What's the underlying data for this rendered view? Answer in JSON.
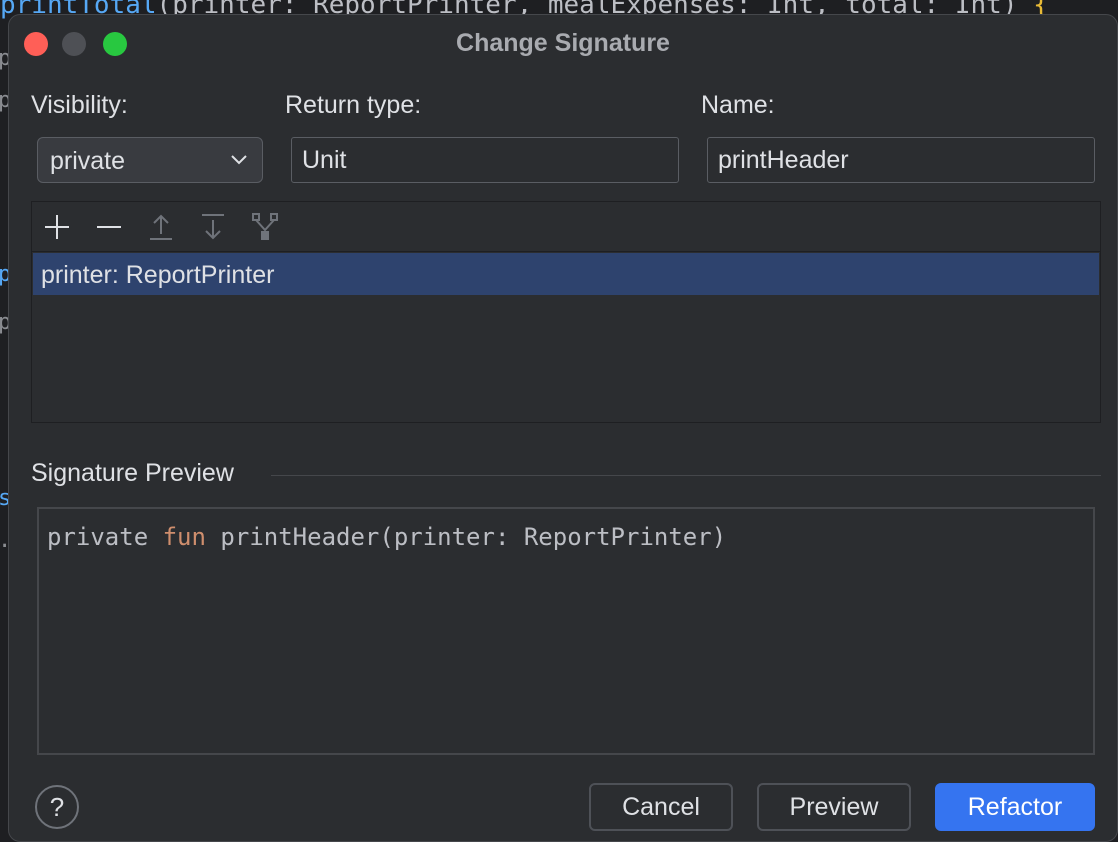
{
  "background_editor": {
    "code_fn": "printTotal",
    "code_rest": "(printer: ReportPrinter, mealExpenses: Int, total: Int)",
    "code_brace": "{",
    "gutter": [
      "p",
      "p",
      "p",
      "p",
      "s",
      "."
    ]
  },
  "dialog": {
    "title": "Change Signature",
    "visibility": {
      "label": "Visibility:",
      "value": "private"
    },
    "return_type": {
      "label": "Return type:",
      "value": "Unit"
    },
    "name": {
      "label": "Name:",
      "value": "printHeader"
    },
    "parameters": {
      "toolbar": [
        "add-icon",
        "remove-icon",
        "move-up-icon",
        "move-down-icon",
        "propagate-icon"
      ],
      "items": [
        {
          "text": "printer: ReportPrinter",
          "selected": true
        }
      ]
    },
    "signature_preview": {
      "title": "Signature Preview",
      "modifier": "private",
      "keyword": "fun",
      "rest": "printHeader(printer: ReportPrinter)"
    },
    "help_label": "?",
    "buttons": {
      "cancel": "Cancel",
      "preview": "Preview",
      "refactor": "Refactor"
    }
  },
  "colors": {
    "accent": "#3574f0",
    "selection": "#2e436e",
    "keyword": "#cf8e6d",
    "close": "#ff5f57",
    "zoom": "#28c840"
  }
}
